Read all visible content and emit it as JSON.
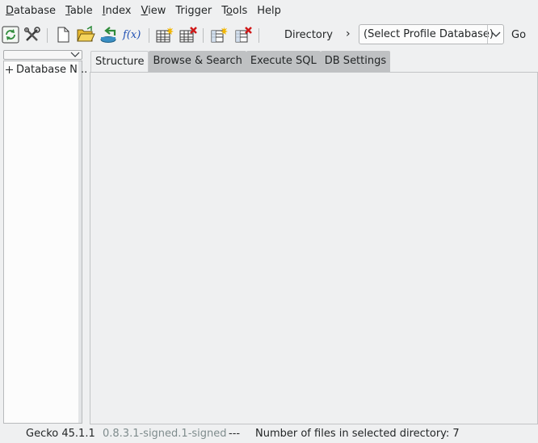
{
  "menubar": {
    "items": [
      {
        "label": "Database",
        "mnemonic": "D",
        "rest": "atabase"
      },
      {
        "label": "Table",
        "mnemonic": "T",
        "rest": "able"
      },
      {
        "label": "Index",
        "mnemonic": "I",
        "rest": "ndex"
      },
      {
        "label": "View",
        "mnemonic": "V",
        "rest": "iew"
      },
      {
        "label": "Trigger",
        "mnemonic": "",
        "rest": "Trigger"
      },
      {
        "label": "Tools",
        "pre": "T",
        "mnemonic": "o",
        "rest": "ols"
      },
      {
        "label": "Help",
        "mnemonic": "",
        "rest": "Help"
      }
    ]
  },
  "toolbar": {
    "directory_label": "Directory",
    "chevron": "›",
    "profile_select_value": "(Select Profile Database)",
    "go_label": "Go",
    "icons": [
      "refresh-icon",
      "tools-icon",
      "new-database-icon",
      "open-database-icon",
      "import-icon",
      "function-icon",
      "create-table-icon",
      "drop-table-icon",
      "create-index-icon",
      "drop-index-icon"
    ]
  },
  "left_panel": {
    "tree_item_label": "Database N..."
  },
  "tabs": [
    {
      "label": "Structure",
      "active": true
    },
    {
      "label": "Browse & Search",
      "active": false
    },
    {
      "label": "Execute SQL",
      "active": false
    },
    {
      "label": "DB Settings",
      "active": false
    }
  ],
  "statusbar": {
    "engine": "Gecko 45.1.1",
    "version": "0.8.3.1-signed.1-signed",
    "separator": "---",
    "files_info": "Number of files in selected directory: 7"
  },
  "colors": {
    "background": "#eff0f1",
    "tab_inactive": "#bfc1c3",
    "status_muted": "#7f8c8d",
    "text": "#232627"
  }
}
